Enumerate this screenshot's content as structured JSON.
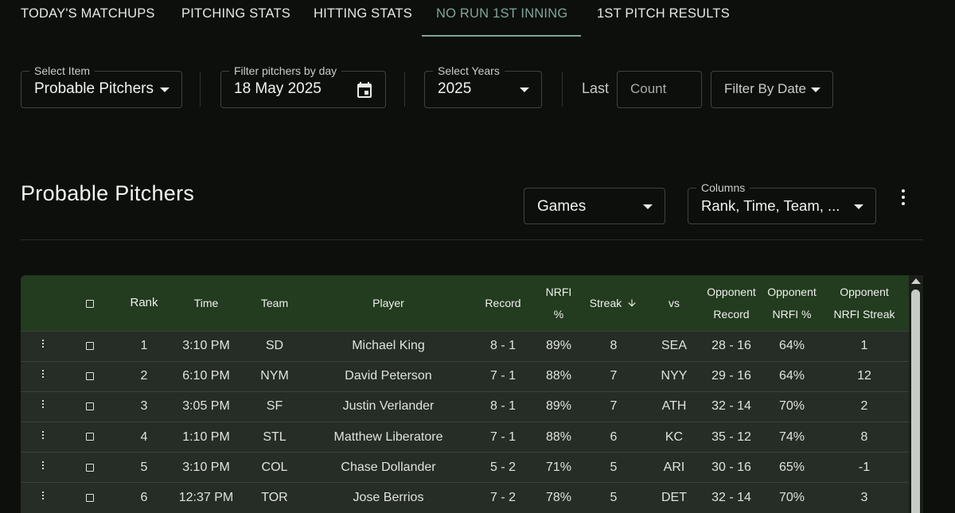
{
  "nav": {
    "tabs": [
      {
        "label": "TODAY'S MATCHUPS"
      },
      {
        "label": "PITCHING STATS"
      },
      {
        "label": "HITTING STATS"
      },
      {
        "label": "NO RUN 1ST INNING",
        "active": true
      },
      {
        "label": "1ST PITCH RESULTS"
      }
    ]
  },
  "filters": {
    "select_item": {
      "legend": "Select Item",
      "value": "Probable Pitchers"
    },
    "filter_day": {
      "legend": "Filter pitchers by day",
      "value": "18 May 2025"
    },
    "select_years": {
      "legend": "Select Years",
      "value": "2025"
    },
    "last_label": "Last",
    "count_placeholder": "Count",
    "filter_by_date": "Filter By Date"
  },
  "section": {
    "title": "Probable Pitchers",
    "games_select": "Games",
    "columns": {
      "legend": "Columns",
      "value": "Rank, Time, Team, ..."
    }
  },
  "table": {
    "headers": {
      "rank": "Rank",
      "time": "Time",
      "team": "Team",
      "player": "Player",
      "record": "Record",
      "nrfi": "NRFI %",
      "streak": "Streak",
      "vs": "vs",
      "opp_record_1": "Opponent",
      "opp_record_2": "Record",
      "opp_nrfi_1": "Opponent",
      "opp_nrfi_2": "NRFI %",
      "opp_streak_1": "Opponent",
      "opp_streak_2": "NRFI Streak"
    },
    "sort": {
      "column": "Streak",
      "direction": "desc"
    },
    "rows": [
      {
        "rank": "1",
        "time": "3:10 PM",
        "team": "SD",
        "player": "Michael King",
        "record": "8 - 1",
        "nrfi": "89%",
        "streak": "8",
        "vs": "SEA",
        "opp_record": "28 - 16",
        "opp_nrfi": "64%",
        "opp_streak": "1"
      },
      {
        "rank": "2",
        "time": "6:10 PM",
        "team": "NYM",
        "player": "David Peterson",
        "record": "7 - 1",
        "nrfi": "88%",
        "streak": "7",
        "vs": "NYY",
        "opp_record": "29 - 16",
        "opp_nrfi": "64%",
        "opp_streak": "12"
      },
      {
        "rank": "3",
        "time": "3:05 PM",
        "team": "SF",
        "player": "Justin Verlander",
        "record": "8 - 1",
        "nrfi": "89%",
        "streak": "7",
        "vs": "ATH",
        "opp_record": "32 - 14",
        "opp_nrfi": "70%",
        "opp_streak": "2"
      },
      {
        "rank": "4",
        "time": "1:10 PM",
        "team": "STL",
        "player": "Matthew Liberatore",
        "record": "7 - 1",
        "nrfi": "88%",
        "streak": "6",
        "vs": "KC",
        "opp_record": "35 - 12",
        "opp_nrfi": "74%",
        "opp_streak": "8"
      },
      {
        "rank": "5",
        "time": "3:10 PM",
        "team": "COL",
        "player": "Chase Dollander",
        "record": "5 - 2",
        "nrfi": "71%",
        "streak": "5",
        "vs": "ARI",
        "opp_record": "30 - 16",
        "opp_nrfi": "65%",
        "opp_streak": "-1"
      },
      {
        "rank": "6",
        "time": "12:37 PM",
        "team": "TOR",
        "player": "Jose Berrios",
        "record": "7 - 2",
        "nrfi": "78%",
        "streak": "5",
        "vs": "DET",
        "opp_record": "32 - 14",
        "opp_nrfi": "70%",
        "opp_streak": "3"
      }
    ]
  },
  "icons": {
    "calendar": "calendar-icon",
    "dropdown": "chevron-down-icon",
    "more": "more-vertical-icon",
    "sort": "arrow-down-icon"
  },
  "colors": {
    "background": "#0c0f0c",
    "active_tab": "#7fa59a",
    "table_header": "#233b1f",
    "table_row": "#262c26"
  }
}
